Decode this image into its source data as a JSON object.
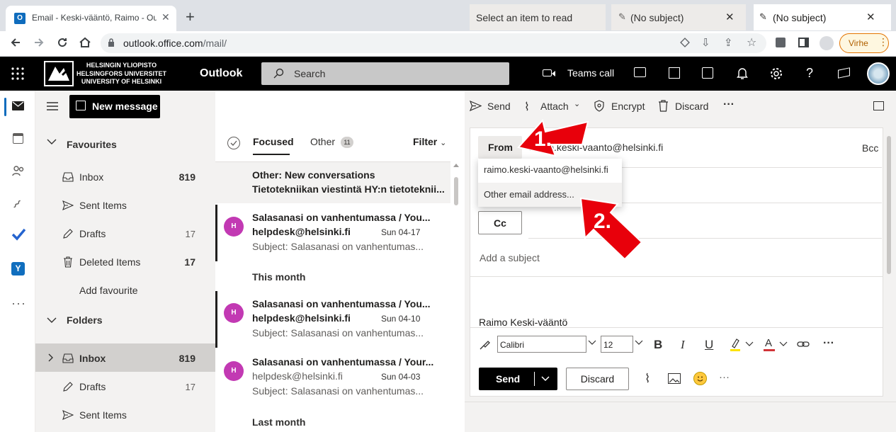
{
  "browser": {
    "tab_title": "Email - Keski-vääntö, Raimo - Ou",
    "new_tab": "+",
    "url_host": "outlook.office.com",
    "url_path": "/mail/",
    "profile_label": "Virhe",
    "window_controls": [
      "minimize",
      "maximize",
      "close"
    ]
  },
  "header": {
    "org_line1": "HELSINGIN YLIOPISTO",
    "org_line2": "HELSINGFORS UNIVERSITET",
    "org_line3": "UNIVERSITY OF HELSINKI",
    "app_name": "Outlook",
    "search_placeholder": "Search",
    "teams_call": "Teams call"
  },
  "folders": {
    "new_message": "New message",
    "favourites_label": "Favourites",
    "favourites": [
      {
        "label": "Inbox",
        "count": "819",
        "icon": "inbox-icon",
        "count_bold": true
      },
      {
        "label": "Sent Items",
        "count": "",
        "icon": "send-icon"
      },
      {
        "label": "Drafts",
        "count": "17",
        "icon": "pencil-icon",
        "count_bold": false
      },
      {
        "label": "Deleted Items",
        "count": "17",
        "icon": "trash-icon",
        "count_bold": true
      }
    ],
    "add_favourite": "Add favourite",
    "folders_label": "Folders",
    "folders": [
      {
        "label": "Inbox",
        "count": "819",
        "icon": "inbox-icon",
        "count_bold": true
      },
      {
        "label": "Drafts",
        "count": "17",
        "icon": "pencil-icon",
        "count_bold": false
      },
      {
        "label": "Sent Items",
        "count": "",
        "icon": "send-icon"
      }
    ]
  },
  "list": {
    "focused_tab": "Focused",
    "other_tab": "Other",
    "other_count": "11",
    "filter": "Filter",
    "other_conv_title": "Other: New conversations",
    "other_conv_sub": "Tietotekniikan viestintä HY:n tietoteknii...",
    "section_this_month": "This month",
    "section_last_month": "Last month",
    "messages": [
      {
        "subject": "Salasanasi on vanhentumassa / You...",
        "from": "helpdesk@helsinki.fi",
        "date": "Sun 04-17",
        "preview": "Subject: Salasanasi on vanhentumas...",
        "avatar": "H",
        "unread": true
      },
      {
        "subject": "Salasanasi on vanhentumassa / You...",
        "from": "helpdesk@helsinki.fi",
        "date": "Sun 04-10",
        "preview": "Subject: Salasanasi on vanhentumas...",
        "avatar": "H",
        "unread": true
      },
      {
        "subject": "Salasanasi on vanhentumassa / Your...",
        "from": "helpdesk@helsinki.fi",
        "date": "Sun 04-03",
        "preview": "Subject: Salasanasi on vanhentumas...",
        "avatar": "H",
        "unread": false
      }
    ]
  },
  "compose": {
    "send": "Send",
    "attach": "Attach",
    "encrypt": "Encrypt",
    "discard": "Discard",
    "more": "···",
    "from_btn": "From",
    "from_address": "raimo.keski-vaanto@helsinki.fi",
    "bcc": "Bcc",
    "cc": "Cc",
    "subject_placeholder": "Add a subject",
    "signature": "Raimo Keski-vääntö",
    "font": "Calibri",
    "font_size": "12",
    "send_btn": "Send",
    "discard_btn": "Discard",
    "dropdown_items": [
      "raimo.keski-vaanto@helsinki.fi",
      "Other email address..."
    ],
    "annotation_1": "1.",
    "annotation_2": "2.",
    "arrow_color": "#e8000b"
  },
  "bottom_tabs": {
    "read_tab": "Select an item to read",
    "draft_tab_1": "(No subject)",
    "draft_tab_2": "(No subject)"
  }
}
